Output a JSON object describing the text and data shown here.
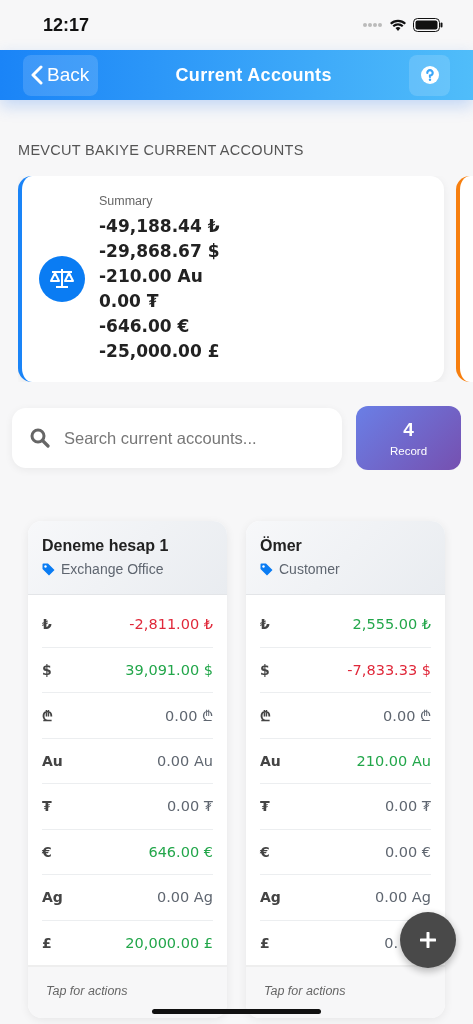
{
  "status_bar": {
    "time": "12:17"
  },
  "header": {
    "back_label": "Back",
    "title": "Current Accounts"
  },
  "section_title": "MEVCUT BAKIYE CURRENT ACCOUNTS",
  "summary": {
    "label": "Summary",
    "totals": [
      "-49,188.44 ₺",
      "-29,868.67 $",
      "-210.00 Au",
      "0.00 ₮",
      "-646.00 €",
      "-25,000.00 £"
    ]
  },
  "search": {
    "placeholder": "Search current accounts..."
  },
  "record_count": {
    "count": "4",
    "label": "Record"
  },
  "accounts": [
    {
      "name": "Deneme hesap 1",
      "type": "Exchange Office",
      "footer": "Tap for actions",
      "balances": [
        {
          "currency": "₺",
          "amount": "-2,811.00 ₺",
          "color": "#e0283a"
        },
        {
          "currency": "$",
          "amount": "39,091.00 $",
          "color": "#22a64a"
        },
        {
          "currency": "₾",
          "amount": "0.00 ₾",
          "color": "#5f6670"
        },
        {
          "currency": "Au",
          "amount": "0.00 Au",
          "color": "#5f6670"
        },
        {
          "currency": "₮",
          "amount": "0.00 ₮",
          "color": "#5f6670"
        },
        {
          "currency": "€",
          "amount": "646.00 €",
          "color": "#22a64a"
        },
        {
          "currency": "Ag",
          "amount": "0.00 Ag",
          "color": "#5f6670"
        },
        {
          "currency": "£",
          "amount": "20,000.00 £",
          "color": "#22a64a"
        }
      ]
    },
    {
      "name": "Ömer",
      "type": "Customer",
      "footer": "Tap for actions",
      "balances": [
        {
          "currency": "₺",
          "amount": "2,555.00 ₺",
          "color": "#22a64a"
        },
        {
          "currency": "$",
          "amount": "-7,833.33 $",
          "color": "#e0283a"
        },
        {
          "currency": "₾",
          "amount": "0.00 ₾",
          "color": "#5f6670"
        },
        {
          "currency": "Au",
          "amount": "210.00 Au",
          "color": "#22a64a"
        },
        {
          "currency": "₮",
          "amount": "0.00 ₮",
          "color": "#5f6670"
        },
        {
          "currency": "€",
          "amount": "0.00 €",
          "color": "#5f6670"
        },
        {
          "currency": "Ag",
          "amount": "0.00 Ag",
          "color": "#5f6670"
        },
        {
          "currency": "£",
          "amount": "0.",
          "color": "#5f6670"
        }
      ]
    }
  ]
}
